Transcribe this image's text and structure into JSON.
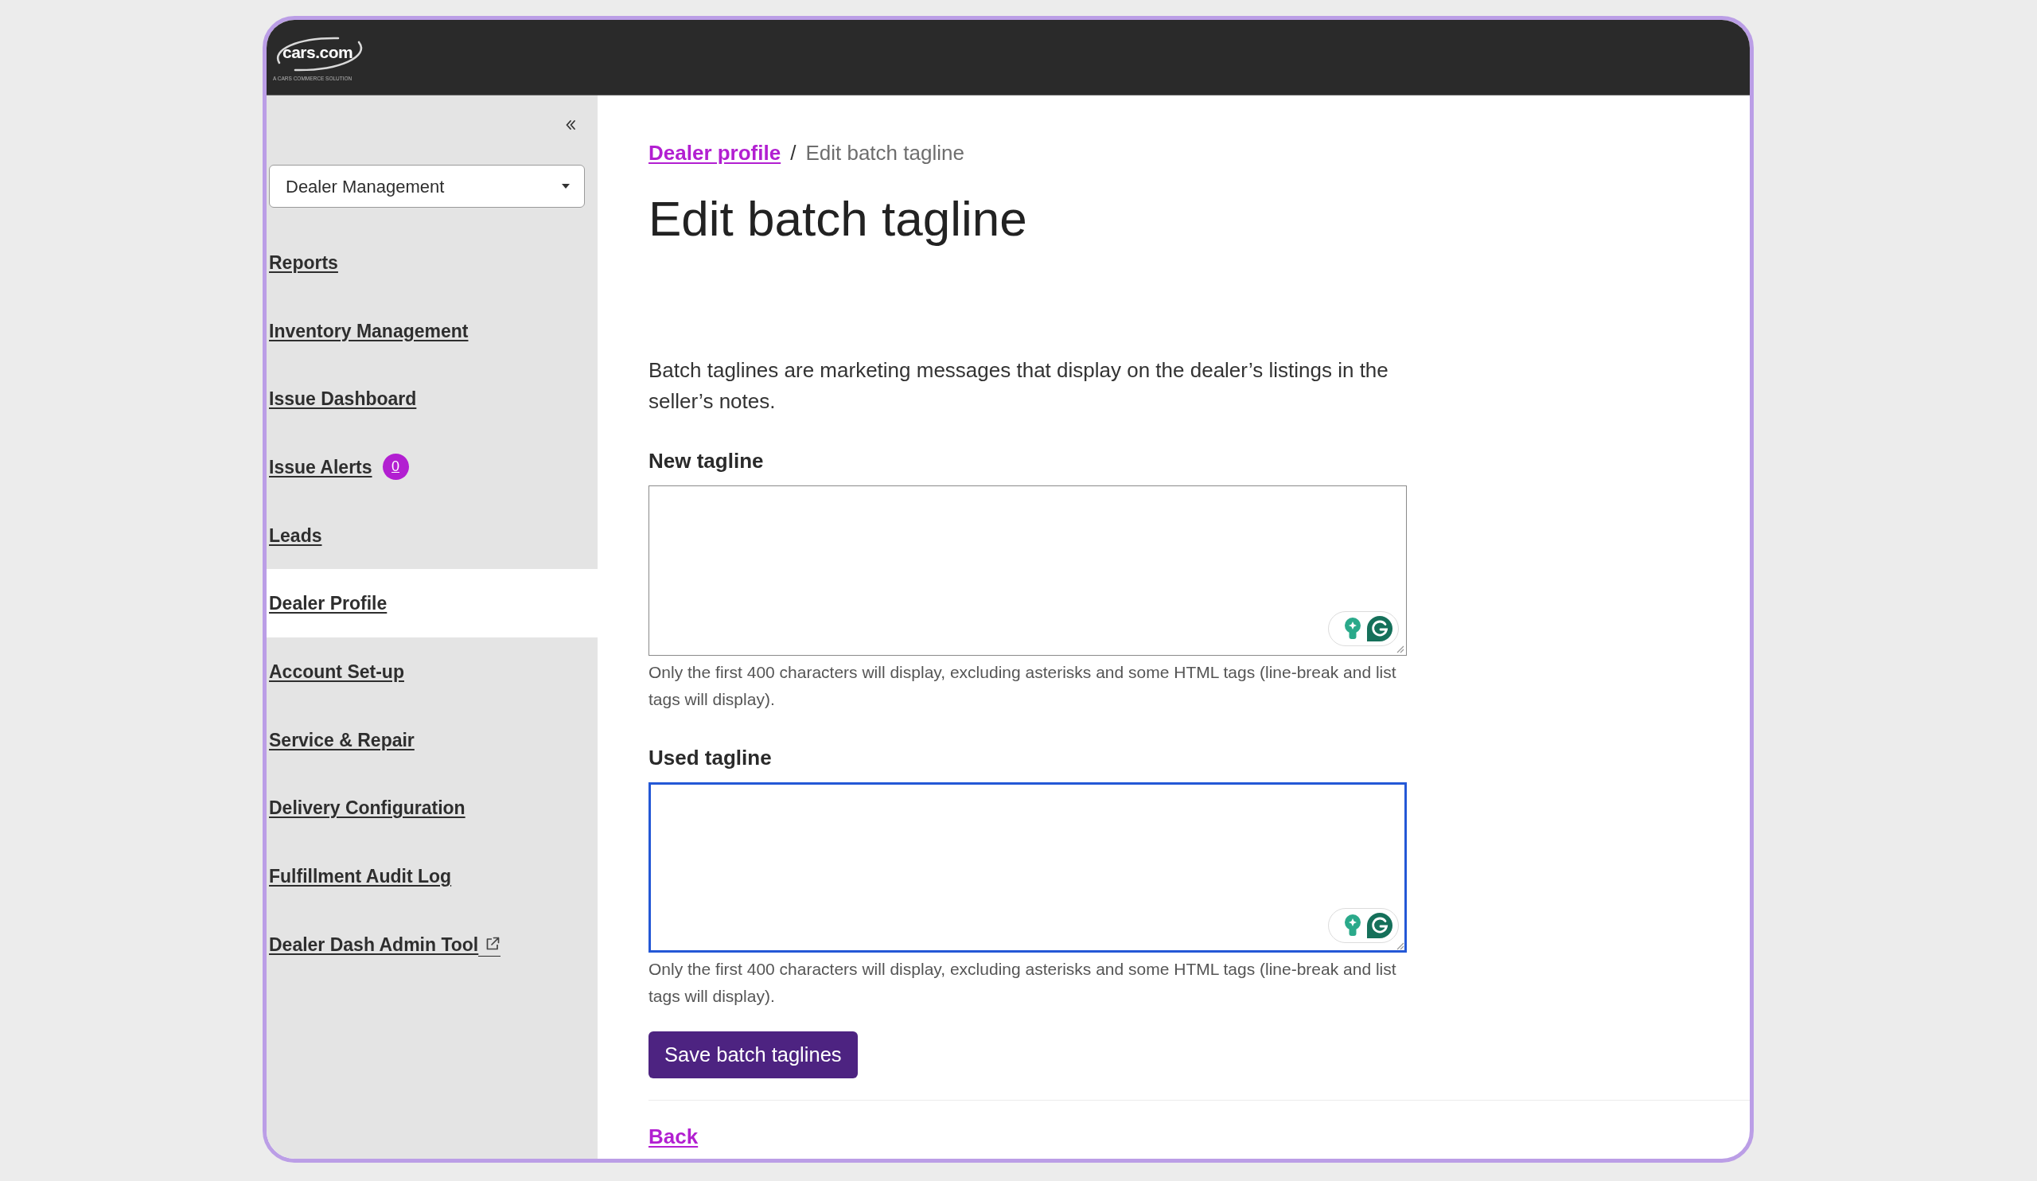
{
  "header": {
    "logo": {
      "wordmark": "cars.com",
      "tagline": "A CARS COMMERCE SOLUTION"
    }
  },
  "sidebar": {
    "selector": {
      "value": "Dealer Management"
    },
    "items": [
      {
        "label": "Reports",
        "selected": false,
        "external": false
      },
      {
        "label": "Inventory Management",
        "selected": false,
        "external": false
      },
      {
        "label": "Issue Dashboard",
        "selected": false,
        "external": false
      },
      {
        "label": "Issue Alerts",
        "selected": false,
        "external": false,
        "badge": "0"
      },
      {
        "label": "Leads",
        "selected": false,
        "external": false
      },
      {
        "label": "Dealer Profile",
        "selected": true,
        "external": false
      },
      {
        "label": "Account Set-up",
        "selected": false,
        "external": false
      },
      {
        "label": "Service & Repair",
        "selected": false,
        "external": false
      },
      {
        "label": "Delivery Configuration",
        "selected": false,
        "external": false
      },
      {
        "label": "Fulfillment Audit Log",
        "selected": false,
        "external": false
      },
      {
        "label": "Dealer Dash Admin Tool",
        "selected": false,
        "external": true
      }
    ]
  },
  "breadcrumb": [
    {
      "kind": "link",
      "label": "Dealer profile"
    },
    {
      "kind": "separator",
      "label": "/"
    },
    {
      "kind": "current",
      "label": "Edit batch tagline"
    }
  ],
  "title": "Edit batch tagline",
  "description": "Batch taglines are marketing messages that display on the dealer’s listings in the seller’s notes.",
  "fields": [
    {
      "label": "New tagline",
      "focused": false,
      "help": "Only the first 400 characters will display, excluding asterisks and some HTML tags (line-break and list tags will display)."
    },
    {
      "label": "Used tagline",
      "focused": true,
      "help": "Only the first 400 characters will display, excluding asterisks and some HTML tags (line-break and list tags will display)."
    }
  ],
  "save_button": "Save batch taglines",
  "back_link": "Back"
}
